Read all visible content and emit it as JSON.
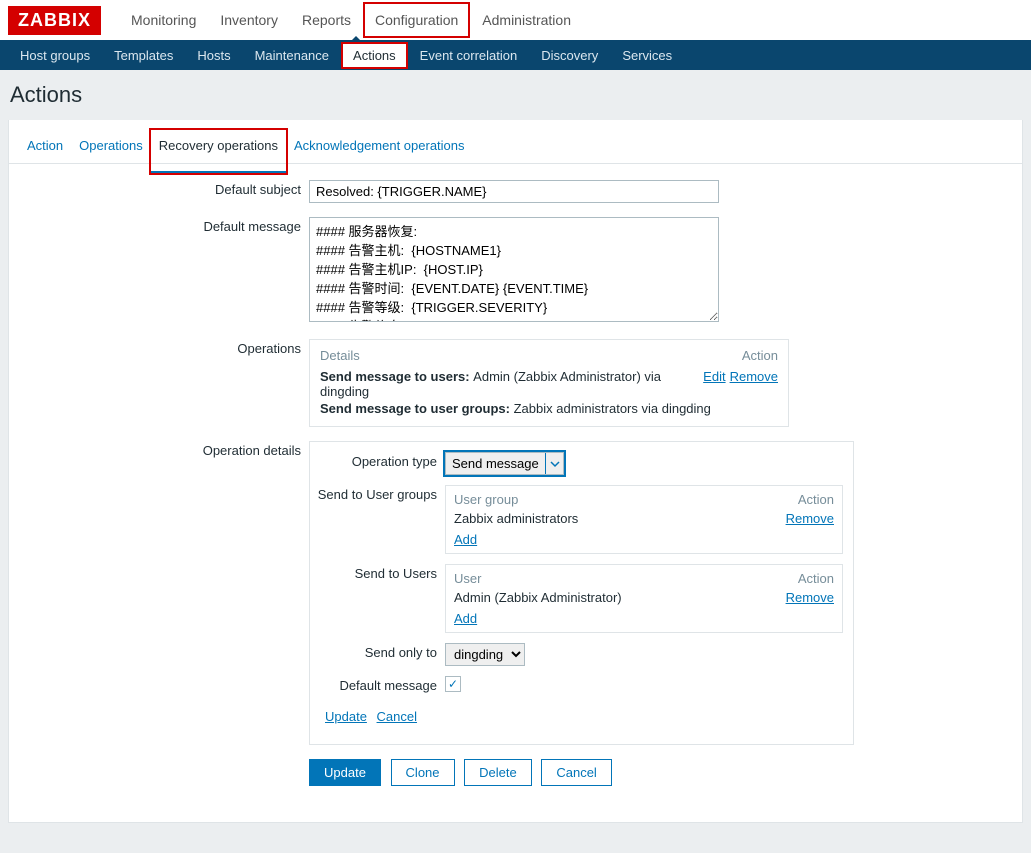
{
  "brand": "ZABBIX",
  "topmenu": [
    "Monitoring",
    "Inventory",
    "Reports",
    "Configuration",
    "Administration"
  ],
  "topmenu_active": 3,
  "submenu": [
    "Host groups",
    "Templates",
    "Hosts",
    "Maintenance",
    "Actions",
    "Event correlation",
    "Discovery",
    "Services"
  ],
  "submenu_active": 4,
  "page_title": "Actions",
  "tabs": [
    "Action",
    "Operations",
    "Recovery operations",
    "Acknowledgement operations"
  ],
  "tabs_active": 2,
  "form": {
    "default_subject_label": "Default subject",
    "default_subject_value": "Resolved: {TRIGGER.NAME}",
    "default_message_label": "Default message",
    "default_message_value": "#### 服务器恢复:\n#### 告警主机:  {HOSTNAME1}\n#### 告警主机IP:  {HOST.IP}\n#### 告警时间:  {EVENT.DATE} {EVENT.TIME}\n#### 告警等级:  {TRIGGER.SEVERITY}\n#### 告警信息:  {TRIGGER.NAME}\n#### 告警项目:  {TRIGGER.KEY1}\n#### 问题详情:  {ITEM.NAME}:{ITEM.VALUE}",
    "operations_label": "Operations",
    "op_details_h": "Details",
    "op_action_h": "Action",
    "op_line1_bold": "Send message to users: ",
    "op_line1_rest": "Admin (Zabbix Administrator) via dingding",
    "op_line2_bold": "Send message to user groups: ",
    "op_line2_rest": "Zabbix administrators via dingding",
    "edit": "Edit",
    "remove": "Remove",
    "operation_details_label": "Operation details",
    "operation_type_label": "Operation type",
    "operation_type_value": "Send message",
    "send_to_ug_label": "Send to User groups",
    "ug_header": "User group",
    "ug_value": "Zabbix administrators",
    "add": "Add",
    "send_to_u_label": "Send to Users",
    "u_header": "User",
    "u_value": "Admin (Zabbix Administrator)",
    "send_only_to_label": "Send only to",
    "send_only_to_value": "dingding",
    "default_msg_chk_label": "Default message",
    "update_link": "Update",
    "cancel_link": "Cancel",
    "btn_update": "Update",
    "btn_clone": "Clone",
    "btn_delete": "Delete",
    "btn_cancel": "Cancel"
  }
}
